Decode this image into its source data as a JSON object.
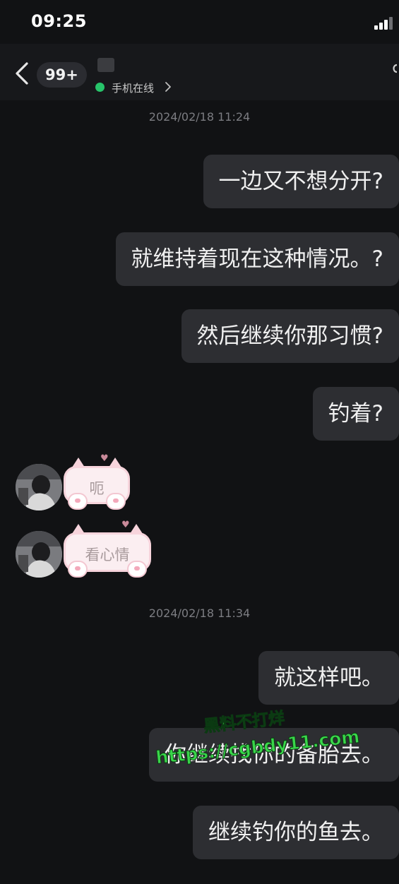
{
  "status_bar": {
    "time": "09:25"
  },
  "header": {
    "unread_count": "99+",
    "online_status": "手机在线"
  },
  "timestamps": [
    "2024/02/18 11:24",
    "2024/02/18 11:34"
  ],
  "sent_group_1": [
    "一边又不想分开?",
    "就维持着现在这种情况。?",
    "然后继续你那习惯?",
    "钓着?"
  ],
  "received": [
    {
      "sticker_text": "呃"
    },
    {
      "sticker_text": "看心情"
    }
  ],
  "sent_group_2": [
    "就这样吧。",
    "你继续找你的备胎去。",
    "继续钓你的鱼去。"
  ],
  "watermark": {
    "line1": "黑料不打烊",
    "line2": "https://cgbdy11.com"
  },
  "colors": {
    "background": "#111214",
    "bubble": "#2d2e32",
    "online": "#27c46a",
    "watermark": "#39d64a"
  }
}
